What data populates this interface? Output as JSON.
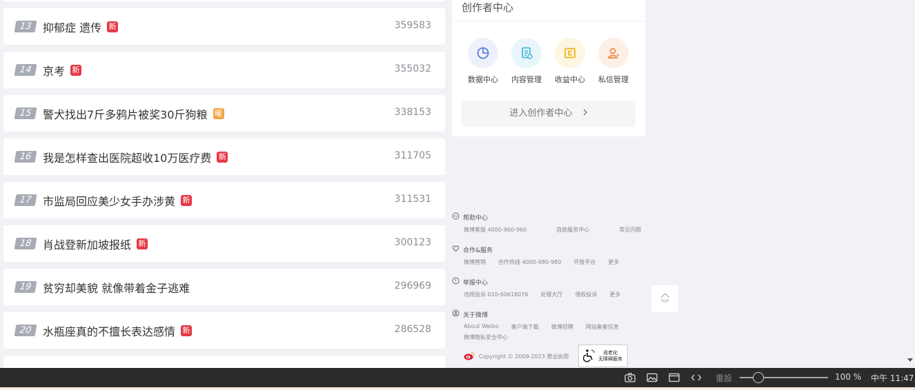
{
  "hot_list": [
    {
      "rank": "13",
      "title": "抑郁症 遗传",
      "badge": "新",
      "badge_type": "new",
      "count": "359583"
    },
    {
      "rank": "14",
      "title": "京考",
      "badge": "新",
      "badge_type": "new",
      "count": "355032"
    },
    {
      "rank": "15",
      "title": "警犬找出7斤多鸦片被奖30斤狗粮",
      "badge": "暖",
      "badge_type": "hot",
      "count": "338153"
    },
    {
      "rank": "16",
      "title": "我是怎样查出医院超收10万医疗费",
      "badge": "新",
      "badge_type": "new",
      "count": "311705"
    },
    {
      "rank": "17",
      "title": "市监局回应美少女手办涉黄",
      "badge": "新",
      "badge_type": "new",
      "count": "311531"
    },
    {
      "rank": "18",
      "title": "肖战登新加坡报纸",
      "badge": "新",
      "badge_type": "new",
      "count": "300123"
    },
    {
      "rank": "19",
      "title": "贫穷却美貌 就像带着金子逃难",
      "badge": "",
      "badge_type": "",
      "count": "296969"
    },
    {
      "rank": "20",
      "title": "水瓶座真的不擅长表达感情",
      "badge": "新",
      "badge_type": "new",
      "count": "286528"
    }
  ],
  "creator": {
    "title": "创作者中心",
    "tools": [
      {
        "label": "数据中心",
        "icon": "pie-chart-icon",
        "bg": "#eef1fb",
        "color": "#5b7fd6"
      },
      {
        "label": "内容管理",
        "icon": "document-icon",
        "bg": "#e8f6fb",
        "color": "#3fb5d8"
      },
      {
        "label": "收益中心",
        "icon": "wallet-icon",
        "bg": "#fdf6e3",
        "color": "#f0b21a"
      },
      {
        "label": "私信管理",
        "icon": "user-message-icon",
        "bg": "#fdefe6",
        "color": "#f08a45"
      }
    ],
    "enter_label": "进入创作者中心",
    "enter_arrow": ">"
  },
  "footer": {
    "sections": [
      {
        "title": "帮助中心",
        "icon": "help-icon",
        "links": [
          "微博客服 4000-960-960",
          "自助服务中心",
          "常见问题"
        ]
      },
      {
        "title": "合作&服务",
        "icon": "handshake-icon",
        "links": [
          "微博营销",
          "合作热线 4000-980-980",
          "开放平台",
          "更多"
        ]
      },
      {
        "title": "举报中心",
        "icon": "report-icon",
        "links": [
          "违规投诉 010-60618076",
          "处理大厅",
          "侵权投诉",
          "更多"
        ]
      },
      {
        "title": "关于微博",
        "icon": "about-icon",
        "links": [
          "About Weibo",
          "客户端下载",
          "微博招聘",
          "网站备案信息"
        ],
        "links2": [
          "微博隐私安全中心"
        ]
      }
    ],
    "copyright": "Copyright © 2009-2023 营业执照",
    "accessibility_line1": "适老化",
    "accessibility_line2": "无障碍服务"
  },
  "top_button": "TOP",
  "taskbar": {
    "reset_label": "重設",
    "zoom": "100 %",
    "time": "中午 11:47"
  }
}
